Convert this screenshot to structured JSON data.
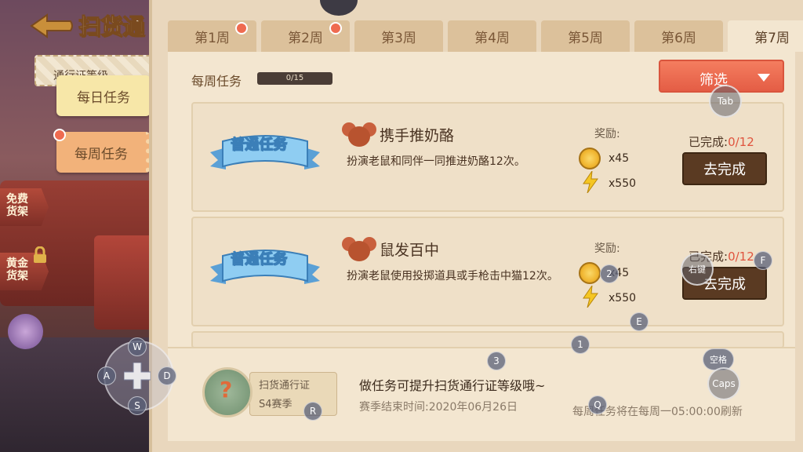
{
  "header": {
    "title": "扫货通"
  },
  "left_panel": {
    "pass_ribbon": "通行证等级",
    "tabs": [
      {
        "label": "每日任务",
        "active": false
      },
      {
        "label": "每周任务",
        "active": true,
        "has_dot": true
      }
    ],
    "side_buttons": [
      {
        "label": "免费货架"
      },
      {
        "label": "黄金货架",
        "locked": true
      }
    ]
  },
  "week_tabs": [
    {
      "label": "第1周",
      "has_dot": true
    },
    {
      "label": "第2周",
      "has_dot": true
    },
    {
      "label": "第3周"
    },
    {
      "label": "第4周"
    },
    {
      "label": "第5周"
    },
    {
      "label": "第6周"
    },
    {
      "label": "第7周",
      "active": true
    }
  ],
  "weekly": {
    "label": "每周任务",
    "progress": "0/15"
  },
  "filter": {
    "label": "筛选"
  },
  "tasks": [
    {
      "type": "普通任务",
      "title": "携手推奶酪",
      "desc": "扮演老鼠和同伴一同推进奶酪12次。",
      "reward_label": "奖励:",
      "coin": "x45",
      "energy": "x550",
      "done_label": "已完成:",
      "done_count": "0/12",
      "button": "去完成"
    },
    {
      "type": "普通任务",
      "title": "鼠发百中",
      "desc": "扮演老鼠使用投掷道具或手枪击中猫12次。",
      "reward_label": "奖励:",
      "coin": "x45",
      "energy": "x550",
      "done_label": "已完成:",
      "done_count": "0/12",
      "button": "去完成"
    }
  ],
  "footer": {
    "pass_name": "扫货通行证",
    "season": "S4赛季",
    "tip": "做任务可提升扫货通行证等级哦~",
    "season_end": "赛季结束时间:2020年06月26日",
    "refresh": "每周任务将在每周一05:00:00刷新"
  },
  "keys": {
    "tab": "Tab",
    "f": "F",
    "right_click": "右键",
    "space": "空格",
    "caps": "Caps",
    "e": "E",
    "one": "1",
    "two": "2",
    "three": "3",
    "q": "Q",
    "r": "R",
    "w": "W",
    "a": "A",
    "s": "S",
    "d": "D"
  },
  "colors": {
    "accent": "#ef6b50",
    "button_dark": "#5a3a22",
    "ribbon_blue": "#7fc0ea"
  }
}
